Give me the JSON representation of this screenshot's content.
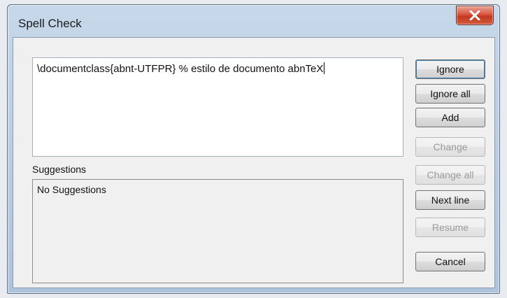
{
  "window": {
    "title": "Spell Check"
  },
  "text_line": {
    "value": "\\documentclass{abnt-UTFPR} % estilo de documento abnTeX"
  },
  "suggestions": {
    "label": "Suggestions",
    "items": [
      "No Suggestions"
    ]
  },
  "buttons": {
    "ignore": {
      "label": "Ignore",
      "enabled": true
    },
    "ignore_all": {
      "label": "Ignore all",
      "enabled": true
    },
    "add": {
      "label": "Add",
      "enabled": true
    },
    "change": {
      "label": "Change",
      "enabled": false
    },
    "change_all": {
      "label": "Change all",
      "enabled": false
    },
    "next_line": {
      "label": "Next line",
      "enabled": true
    },
    "resume": {
      "label": "Resume",
      "enabled": false
    },
    "cancel": {
      "label": "Cancel",
      "enabled": true
    }
  },
  "colors": {
    "close_button": "#c8452c",
    "disabled_text": "#9a9a9a"
  }
}
